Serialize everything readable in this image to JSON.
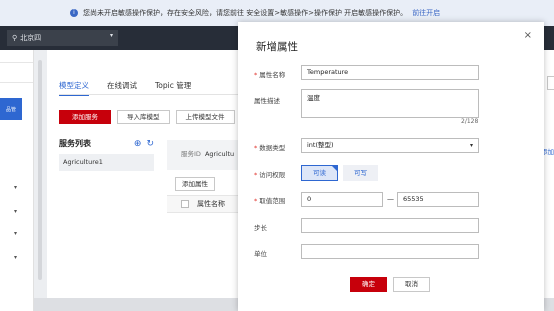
{
  "notice": {
    "text": "您尚未开启敏感操作保护，存在安全风险，请您前往 安全设置>敏感操作>操作保护 开启敏感操作保护。",
    "link": "前往开启"
  },
  "region": {
    "name": "北京四"
  },
  "sidebar": {
    "blue_label": "品管"
  },
  "tabs": [
    "模型定义",
    "在线调试",
    "Topic 管理"
  ],
  "toolbar": {
    "add_service": "添加服务",
    "import_model": "导入库模型",
    "upload_file": "上传模型文件"
  },
  "services": {
    "title": "服务列表",
    "items": [
      "Agriculture1"
    ]
  },
  "detail": {
    "service_id_label": "服务ID",
    "service_id_value": "Agricultu"
  },
  "props_table": {
    "add_button": "添加属性",
    "col_name": "属性名称"
  },
  "right_link": "添加",
  "modal": {
    "title": "新增属性",
    "close": "×",
    "name_label": "属性名称",
    "name_value": "Temperature",
    "desc_label": "属性描述",
    "desc_value": "温度",
    "desc_counter": "2/128",
    "type_label": "数据类型",
    "type_value": "int(整型)",
    "access_label": "访问权限",
    "access_readable": "可读",
    "access_writable": "可写",
    "range_label": "取值范围",
    "range_min": "0",
    "range_max": "65535",
    "step_label": "步长",
    "step_value": "",
    "unit_label": "单位",
    "unit_value": "",
    "ok": "确定",
    "cancel": "取消"
  }
}
